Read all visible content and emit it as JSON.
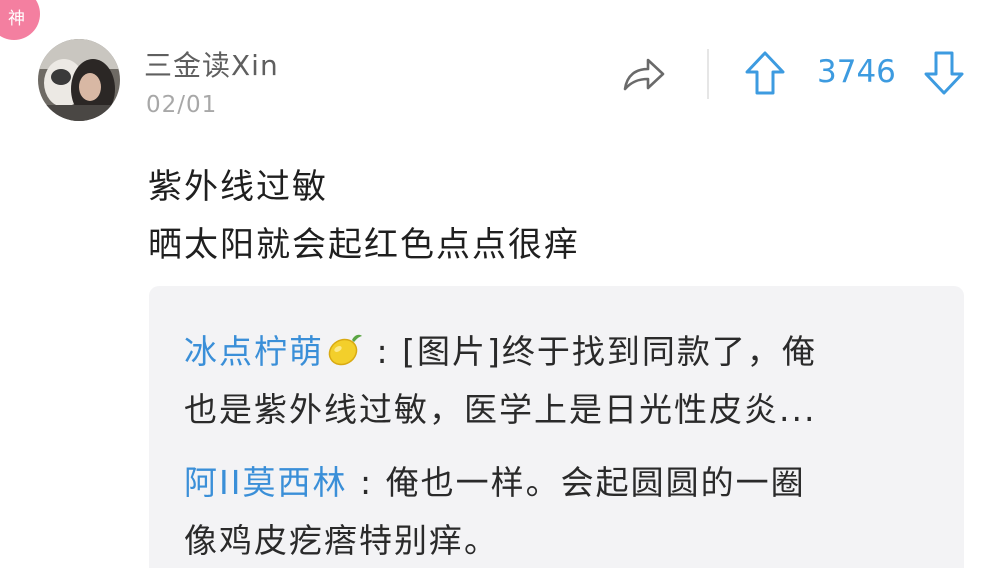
{
  "badge": {
    "label": "神"
  },
  "post": {
    "username": "三金读Xin",
    "date": "02/01",
    "vote_count": "3746",
    "content_lines": [
      "紫外线过敏",
      "晒太阳就会起红色点点很痒"
    ]
  },
  "replies": [
    {
      "author": "冰点柠萌",
      "separator": ":",
      "line1": "[图片]终于找到同款了，俺",
      "line2": "也是紫外线过敏，医学上是日光性皮炎..."
    },
    {
      "author": "阿II莫西林",
      "separator": ":",
      "line1": "俺也一样。会起圆圆的一圈",
      "line2": "像鸡皮疙瘩特别痒。"
    }
  ],
  "icons": {
    "share": "share-arrow-icon",
    "upvote": "upvote-arrow-icon",
    "downvote": "downvote-arrow-icon",
    "lemon": "lemon-emoji-icon"
  },
  "colors": {
    "accent": "#3d9be0",
    "author_link": "#3a8fd8",
    "badge": "#f47fa0",
    "reply_background": "#f3f3f5"
  }
}
